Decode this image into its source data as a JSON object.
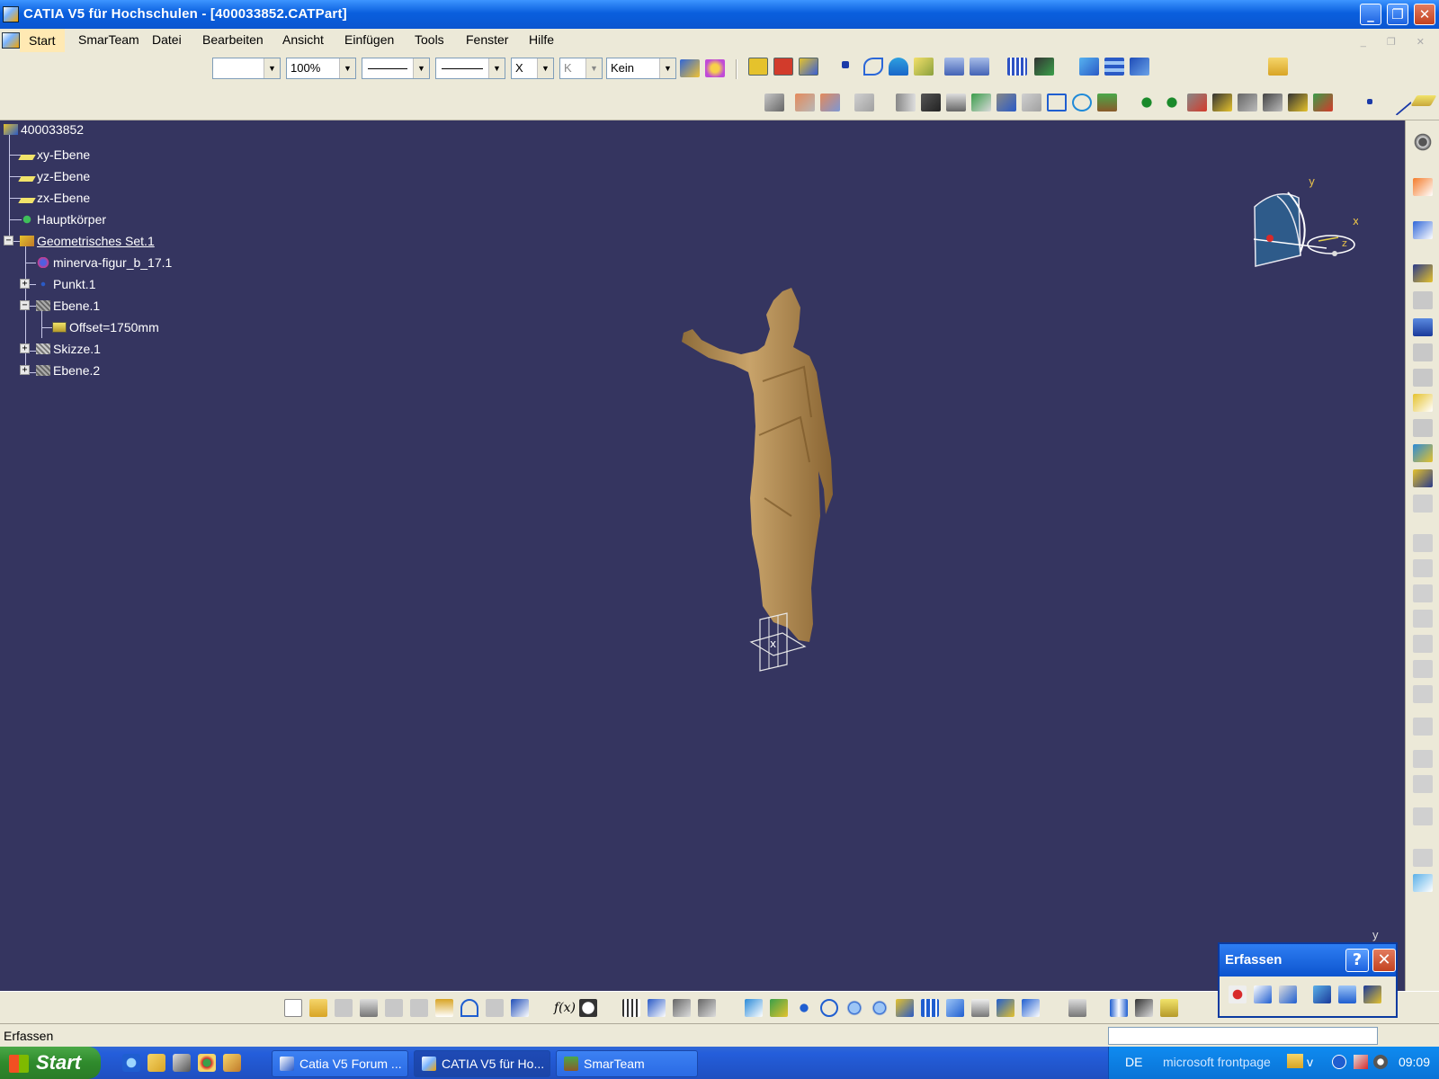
{
  "window": {
    "title": "CATIA V5 für Hochschulen - [400033852.CATPart]",
    "controls": [
      "_",
      "❐",
      "✕"
    ]
  },
  "menu": {
    "items": [
      "Start",
      "SmarTeam",
      "Datei",
      "Bearbeiten",
      "Ansicht",
      "Einfügen",
      "Tools",
      "Fenster",
      "Hilfe"
    ],
    "mdi_controls": "_ ❐ ✕"
  },
  "toolbar": {
    "zoom_value": "100%",
    "layer_value": "Kein",
    "point_value": "X",
    "layer_prefix": "K"
  },
  "tree": {
    "root": "400033852",
    "nodes": [
      {
        "label": "xy-Ebene",
        "icon": "plane-icon"
      },
      {
        "label": "yz-Ebene",
        "icon": "plane-icon"
      },
      {
        "label": "zx-Ebene",
        "icon": "plane-icon"
      },
      {
        "label": "Hauptkörper",
        "icon": "body-icon"
      },
      {
        "label": "Geometrisches Set.1",
        "icon": "geometrical-set-icon"
      },
      {
        "label": "minerva-figur_b_17.1",
        "icon": "cloud-icon"
      },
      {
        "label": "Punkt.1",
        "icon": "point-icon"
      },
      {
        "label": "Ebene.1",
        "icon": "plane-icon"
      },
      {
        "label": "Offset=1750mm",
        "icon": "parameter-icon"
      },
      {
        "label": "Skizze.1",
        "icon": "sketch-icon"
      },
      {
        "label": "Ebene.2",
        "icon": "plane-icon"
      }
    ]
  },
  "compass": {
    "x": "x",
    "y": "y",
    "z": "z"
  },
  "erfassen": {
    "title": "Erfassen",
    "help": "?",
    "close": "✕",
    "axis_y": "y",
    "axis_x": "x"
  },
  "status": {
    "text": "Erfassen"
  },
  "taskbar": {
    "start": "Start",
    "tasks": [
      "Catia V5 Forum ...",
      "CATIA V5 für Ho...",
      "SmarTeam"
    ],
    "tray_lang": "DE",
    "tray_toolbar": "microsoft frontpage",
    "tray_extra": "v",
    "clock": "09:09"
  },
  "colors": {
    "viewport_bg": "#353560",
    "statue": "#b8945a",
    "title_bar": "#0b56d0"
  }
}
